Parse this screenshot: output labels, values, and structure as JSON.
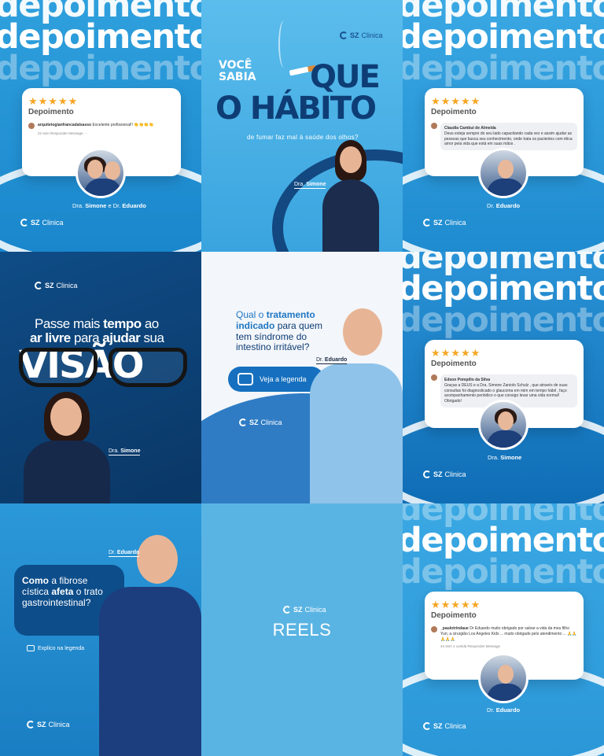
{
  "brand": {
    "name_bold": "SZ",
    "name_rest": "Clinica"
  },
  "tile1": {
    "bigword": "depoimento",
    "stars": "★★★★★",
    "card_title": "Depoimento",
    "comment_user": "arquitetogianfrancadalsasso",
    "comment_text": "Excelente profissional!! 👏👏👏👏",
    "comment_meta": "22 sem   Responder   Message   ···",
    "caption_a": "Dra.",
    "caption_b": "Simone",
    "caption_c": "e Dr.",
    "caption_d": "Eduardo"
  },
  "tile2": {
    "voce": "VOCÊ",
    "sabia": "SABIA",
    "que": "QUE",
    "habito": "O HÁBITO",
    "sub": "de fumar faz mal à saúde dos olhos?",
    "tag_a": "Dra.",
    "tag_b": "Simone"
  },
  "tile3": {
    "bigword": "depoimento",
    "stars": "★★★★★",
    "card_title": "Depoimento",
    "comment_user": "Claudia Cambui de Almeida",
    "comment_text": "Deus esteja sempre do seu lado capacitando cada vez e assim ajudar as pessoas que busca seu conhecimento, onde trata os pacientes com ética amor pela vida que está em suas mãos .",
    "caption_a": "Dr.",
    "caption_b": "Eduardo"
  },
  "tile4": {
    "line1_a": "Passe mais",
    "line1_b": "tempo",
    "line1_c": "ao",
    "line2_a": "ar livre",
    "line2_b": "para",
    "line2_c": "ajudar",
    "line2_d": "sua",
    "visao": "VISÃO",
    "tag_a": "Dra.",
    "tag_b": "Simone"
  },
  "tile5": {
    "q1": "Qual o",
    "q2": "tratamento indicado",
    "q3": "para quem tem síndrome do intestino irritável?",
    "cta": "Veja a legenda",
    "tag_a": "Dr.",
    "tag_b": "Eduardo"
  },
  "tile6": {
    "bigword": "depoimento",
    "stars": "★★★★★",
    "card_title": "Depoimento",
    "comment_user": "Edson Pompílio da Silva",
    "comment_text": "Graças a DEUS e a Dra. Simone Zaniolo Schulz , que através de suas consultas foi diagnosticado o glaucoma em mim em tempo hábil , faço acompanhamento periódico o que consigo levar uma vida normal! Obrigado!",
    "caption_a": "Dra.",
    "caption_b": "Simone"
  },
  "tile7": {
    "como": "Como",
    "q_mid": "a fibrose cística",
    "afeta": "afeta",
    "q_end": "o trato gastrointestinal?",
    "link": "Explico na legenda",
    "tag_a": "Dr.",
    "tag_b": "Eduardo"
  },
  "tile8": {
    "reels": "REELS"
  },
  "tile9": {
    "bigword": "depoimento",
    "stars": "★★★★★",
    "card_title": "Depoimento",
    "comment_user": "_paulotrindaue",
    "comment_text": "Dr Eduardo muito obrigado por salvar a vida da meu filho Yuri, a cirurgião Los Angeles Kids ... muito obrigado pelo atendimento ... 🙏🙏🙏🙏🙏",
    "comment_meta": "44 sem   1 curtida   Responder   Message",
    "caption_a": "Dr.",
    "caption_b": "Eduardo"
  }
}
